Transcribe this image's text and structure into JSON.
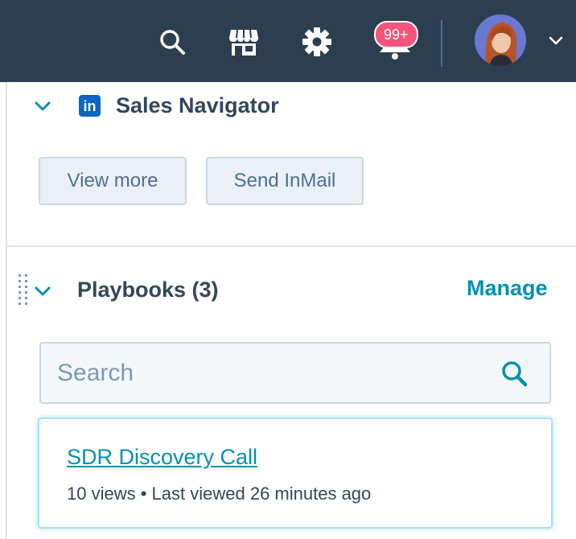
{
  "topbar": {
    "background": "#2d3e50",
    "icons": [
      "search-icon",
      "marketplace-icon",
      "settings-gear-icon",
      "notifications-bell-icon"
    ],
    "notifications_badge": "99+",
    "badge_color": "#f2547d"
  },
  "sales_navigator": {
    "title": "Sales Navigator",
    "logo_text": "in",
    "logo_color": "#0a66c2",
    "view_more_label": "View more",
    "send_inmail_label": "Send InMail"
  },
  "playbooks": {
    "title": "Playbooks (3)",
    "manage_label": "Manage",
    "search_placeholder": "Search",
    "accent": "#0091ae",
    "items": [
      {
        "title": "SDR Discovery Call",
        "views": "10 views",
        "separator": "•",
        "last_viewed": "Last viewed 26 minutes ago"
      }
    ]
  }
}
